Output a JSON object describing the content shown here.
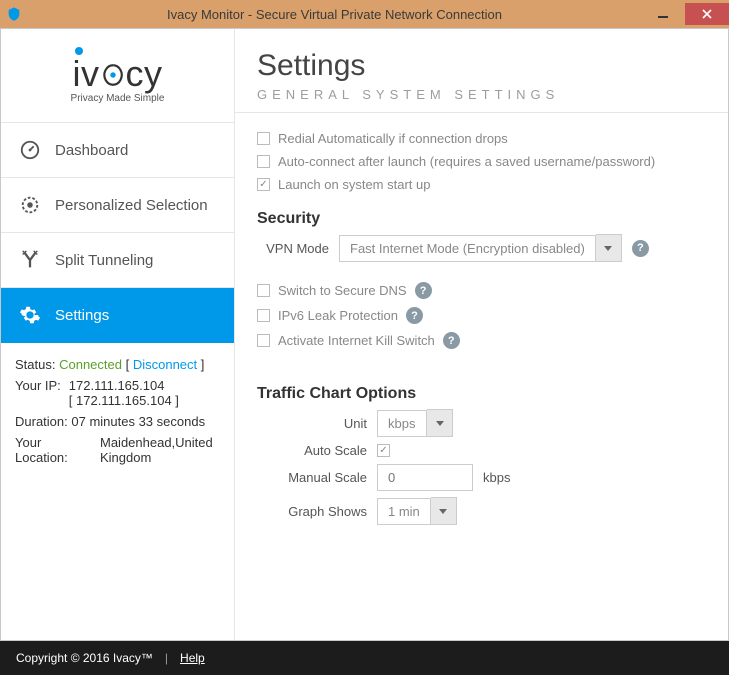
{
  "titlebar": {
    "title": "Ivacy Monitor - Secure Virtual Private Network Connection"
  },
  "brand": {
    "name": "ivacy",
    "tagline": "Privacy Made Simple"
  },
  "sidebar": {
    "items": [
      {
        "label": "Dashboard"
      },
      {
        "label": "Personalized Selection"
      },
      {
        "label": "Split Tunneling"
      },
      {
        "label": "Settings"
      }
    ]
  },
  "status": {
    "label": "Status:",
    "value": "Connected",
    "disconnect": "Disconnect",
    "ip_label": "Your IP:",
    "ip1": "172.111.165.104",
    "ip2": "[ 172.111.165.104 ]",
    "duration_label": "Duration:",
    "duration_value": "07 minutes 33 seconds",
    "location_label": "Your Location:",
    "location_value": "Maidenhead,United Kingdom"
  },
  "header": {
    "title": "Settings",
    "subtitle": "GENERAL SYSTEM SETTINGS"
  },
  "general": {
    "redial": "Redial Automatically if connection drops",
    "autoconnect": "Auto-connect after launch (requires a saved username/password)",
    "launch": "Launch on system start up"
  },
  "security": {
    "title": "Security",
    "vpn_mode_label": "VPN Mode",
    "vpn_mode_value": "Fast Internet Mode (Encryption disabled)",
    "secure_dns": "Switch to Secure DNS",
    "ipv6": "IPv6 Leak Protection",
    "killswitch": "Activate Internet Kill Switch"
  },
  "traffic": {
    "title": "Traffic Chart Options",
    "unit_label": "Unit",
    "unit_value": "kbps",
    "autoscale_label": "Auto Scale",
    "manual_label": "Manual Scale",
    "manual_value": "0",
    "manual_unit": "kbps",
    "graph_label": "Graph Shows",
    "graph_value": "1 min"
  },
  "footer": {
    "copyright": "Copyright © 2016 Ivacy™",
    "help": "Help"
  }
}
